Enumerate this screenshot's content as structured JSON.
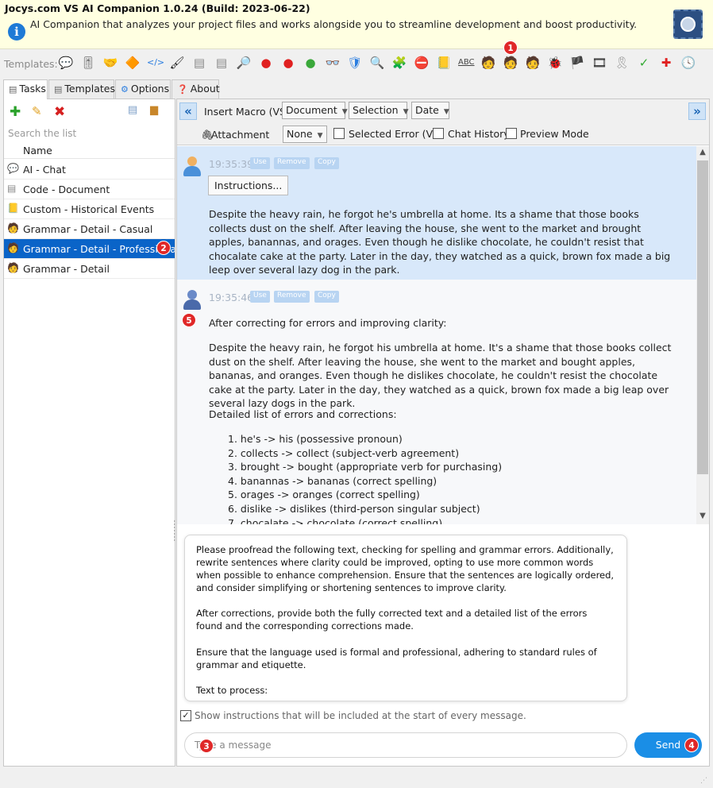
{
  "app": {
    "title": "Jocys.com VS AI Companion 1.0.24 (Build: 2023-06-22)",
    "description": "AI Companion that analyzes your project files and works alongside you to streamline development and boost productivity.",
    "brain_icon": "brain-chip-icon"
  },
  "templates_bar": {
    "label": "Templates:",
    "icons": [
      "chat-bubble",
      "sliders",
      "handshake",
      "shapes",
      "code",
      "brush",
      "document",
      "document-lines",
      "magnifier",
      "error-red",
      "error-red-alt",
      "green-ball",
      "glasses",
      "shield",
      "search",
      "puzzle",
      "no-symbol",
      "notepad",
      "abc-spellcheck",
      "person-casual",
      "person-professional",
      "person-detail",
      "ladybug",
      "flag-uk",
      "film",
      "ribbon",
      "checklist",
      "red-cross",
      "clock-history"
    ],
    "badge": "1"
  },
  "tabs": [
    {
      "label": "Tasks",
      "icon": "document-icon",
      "active": true
    },
    {
      "label": "Templates",
      "icon": "template-icon",
      "active": false
    },
    {
      "label": "Options",
      "icon": "gear-icon",
      "active": false
    },
    {
      "label": "About",
      "icon": "question-icon",
      "active": false
    }
  ],
  "left": {
    "search_placeholder": "Search the list",
    "column_header": "Name",
    "items": [
      {
        "label": "AI - Chat",
        "icon": "chat-bubble-icon",
        "selected": false
      },
      {
        "label": "Code - Document",
        "icon": "code-document-icon",
        "selected": false
      },
      {
        "label": "Custom - Historical Events",
        "icon": "notepad-icon",
        "selected": false
      },
      {
        "label": "Grammar - Detail - Casual",
        "icon": "person-casual-icon",
        "selected": false
      },
      {
        "label": "Grammar - Detail - Professional",
        "icon": "person-professional-icon",
        "selected": true
      },
      {
        "label": "Grammar - Detail",
        "icon": "person-detail-icon",
        "selected": false
      }
    ],
    "badge": "2"
  },
  "toolbar": {
    "insert_macro_label": "Insert Macro (VS)",
    "document_option": "Document",
    "selection_option": "Selection",
    "date_option": "Date",
    "attachment_label": "Attachment",
    "attachment_value": "None",
    "selected_error_label": "Selected Error (VS)",
    "chat_history_label": "Chat History",
    "preview_mode_label": "Preview Mode"
  },
  "messages": {
    "user": {
      "time": "19:35:39",
      "use": "Use",
      "remove": "Remove",
      "copy": "Copy",
      "instructions_button": "Instructions...",
      "text": "Despite the heavy rain, he forgot he's umbrella at home. Its a shame that those books collects dust on the shelf. After leaving the house, she went to the market and brought apples, banannas, and orages. Even though he dislike chocolate, he couldn't resist that chocalate cake at the party. Later in the day, they watched as a quick, brown fox made a big leep over several lazy dog in the park."
    },
    "ai": {
      "time": "19:35:46",
      "use": "Use",
      "remove": "Remove",
      "copy": "Copy",
      "badge": "5",
      "intro": "After correcting for errors and improving clarity:",
      "corrected": "Despite the heavy rain, he forgot his umbrella at home. It's a shame that those books collect dust on the shelf. After leaving the house, she went to the market and bought apples, bananas, and oranges. Even though he dislikes chocolate, he couldn't resist the chocolate cake at the party. Later in the day, they watched as a quick, brown fox made a big leap over several lazy dogs in the park.",
      "list_title": "Detailed list of errors and corrections:",
      "corrections": [
        "he's -> his (possessive pronoun)",
        "collects -> collect (subject-verb agreement)",
        "brought -> bought (appropriate verb for purchasing)",
        "banannas -> bananas (correct spelling)",
        "orages -> oranges (correct spelling)",
        "dislike -> dislikes (third-person singular subject)",
        "chocalate -> chocolate (correct spelling)"
      ]
    }
  },
  "instructions": {
    "p1": "Please proofread the following text, checking for spelling and grammar errors. Additionally, rewrite sentences where clarity could be improved, opting to use more common words when possible to enhance comprehension. Ensure that the sentences are logically ordered, and consider simplifying or shortening sentences to improve clarity.",
    "p2": "After corrections, provide both the fully corrected text and a detailed list of the errors found and the corresponding corrections made.",
    "p3": "Ensure that the language used is formal and professional, adhering to standard rules of grammar and etiquette.",
    "p4": "Text to process:",
    "show_label": "Show instructions that will be included at the start of every message.",
    "show_checked": true
  },
  "composer": {
    "placeholder": "Type a message",
    "input_badge": "3",
    "send_label": "Send",
    "send_badge": "4"
  },
  "colors": {
    "selected_row": "#0a64c8",
    "user_message_bg": "#d8e8fa",
    "send_button": "#1a8ee6",
    "badge": "#e02828",
    "header_bg": "#ffffe1"
  }
}
